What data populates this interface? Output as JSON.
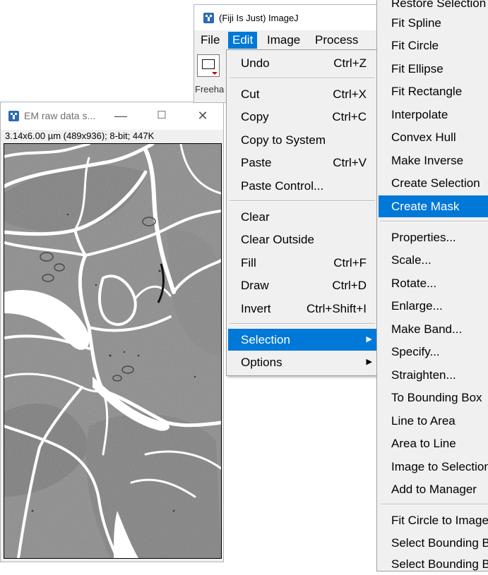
{
  "em_window": {
    "title": "EM raw data s...",
    "info": "3.14x6.00 µm (489x936); 8-bit; 447K",
    "minimize": "—",
    "maximize": "☐",
    "close": "✕"
  },
  "imagej": {
    "title": "(Fiji Is Just) ImageJ",
    "menus": [
      "File",
      "Edit",
      "Image",
      "Process"
    ],
    "active_menu": "Edit",
    "status_text": "Freeha"
  },
  "edit_menu": {
    "items": [
      {
        "label": "Undo",
        "shortcut": "Ctrl+Z"
      },
      {
        "label": "Cut",
        "shortcut": "Ctrl+X"
      },
      {
        "label": "Copy",
        "shortcut": "Ctrl+C"
      },
      {
        "label": "Copy to System",
        "shortcut": ""
      },
      {
        "label": "Paste",
        "shortcut": "Ctrl+V"
      },
      {
        "label": "Paste Control...",
        "shortcut": ""
      },
      {
        "label": "Clear",
        "shortcut": ""
      },
      {
        "label": "Clear Outside",
        "shortcut": ""
      },
      {
        "label": "Fill",
        "shortcut": "Ctrl+F"
      },
      {
        "label": "Draw",
        "shortcut": "Ctrl+D"
      },
      {
        "label": "Invert",
        "shortcut": "Ctrl+Shift+I"
      },
      {
        "label": "Selection",
        "shortcut": ""
      },
      {
        "label": "Options",
        "shortcut": ""
      }
    ],
    "highlighted": "Selection"
  },
  "selection_menu": {
    "items": [
      "Restore Selection",
      "Fit Spline",
      "Fit Circle",
      "Fit Ellipse",
      "Fit Rectangle",
      "Interpolate",
      "Convex Hull",
      "Make Inverse",
      "Create Selection",
      "Create Mask",
      "Properties...",
      "Scale...",
      "Rotate...",
      "Enlarge...",
      "Make Band...",
      "Specify...",
      "Straighten...",
      "To Bounding Box",
      "Line to Area",
      "Area to Line",
      "Image to Selection",
      "Add to Manager",
      "Fit Circle to Image",
      "Select Bounding Box",
      "Select Bounding Box"
    ],
    "highlighted": "Create Mask"
  },
  "colors": {
    "highlight": "#0078d7",
    "menu_bg": "#f0f0f0",
    "fiji_blue": "#2d6ab4"
  }
}
